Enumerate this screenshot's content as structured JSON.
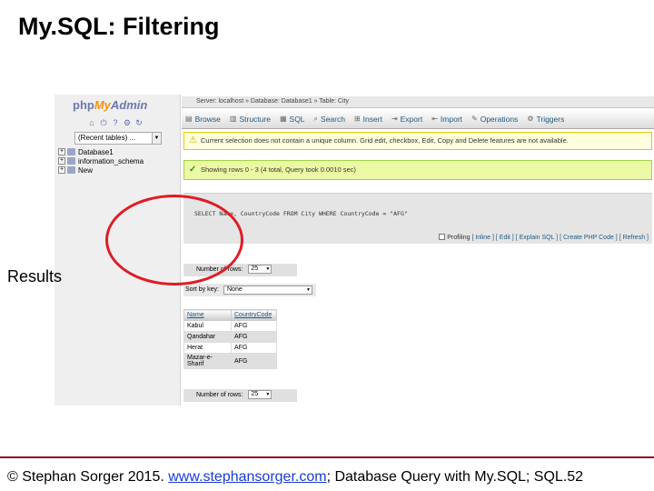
{
  "slide": {
    "title": "My.SQL: Filtering",
    "label": "Results",
    "footer_prefix": "© Stephan Sorger 2015. ",
    "footer_link": "www.stephansorger.com",
    "footer_suffix": "; Database Query with My.SQL;  SQL.52"
  },
  "pma": {
    "logo_php": "php",
    "logo_my": "My",
    "logo_admin": "Admin",
    "recent_select": "(Recent tables) ...",
    "tree": [
      {
        "toggle": "+",
        "label": "Database1"
      },
      {
        "toggle": "+",
        "label": "information_schema"
      },
      {
        "toggle": "+",
        "label": "New"
      }
    ],
    "breadcrumb": "Server: localhost  »  Database: Database1  »  Table: City",
    "tabs": [
      {
        "icon": "browse-icon",
        "glyph": "▤",
        "label": "Browse"
      },
      {
        "icon": "structure-icon",
        "glyph": "▥",
        "label": "Structure"
      },
      {
        "icon": "sql-icon",
        "glyph": "▦",
        "label": "SQL"
      },
      {
        "icon": "search-icon",
        "glyph": "⌕",
        "label": "Search"
      },
      {
        "icon": "insert-icon",
        "glyph": "⊞",
        "label": "Insert"
      },
      {
        "icon": "export-icon",
        "glyph": "⇥",
        "label": "Export"
      },
      {
        "icon": "import-icon",
        "glyph": "⇤",
        "label": "Import"
      },
      {
        "icon": "operations-icon",
        "glyph": "✎",
        "label": "Operations"
      },
      {
        "icon": "triggers-icon",
        "glyph": "⚙",
        "label": "Triggers"
      }
    ],
    "warning": "Current selection does not contain a unique column. Grid edit, checkbox, Edit, Copy and Delete features are not available.",
    "success": "Showing rows 0 - 3 (4 total, Query took 0.0010 sec)",
    "sql": "SELECT Name, CountryCode FROM City WHERE CountryCode = \"AFG\"",
    "sql_links": {
      "profiling": "Profiling",
      "links": "[ Inline ] [ Edit ] [ Explain SQL ] [ Create PHP Code ] [ Refresh ]"
    },
    "rows_label": "Number of rows:",
    "rows_value": "25",
    "sort_label": "Sort by key:",
    "sort_value": "None",
    "results": {
      "headers": [
        "Name",
        "CountryCode"
      ],
      "rows": [
        [
          "Kabul",
          "AFG"
        ],
        [
          "Qandahar",
          "AFG"
        ],
        [
          "Herat",
          "AFG"
        ],
        [
          "Mazar-e-Sharif",
          "AFG"
        ]
      ]
    }
  },
  "colors": {
    "highlight_circle": "#e01b24",
    "footer_rule": "#8a0f1a",
    "link": "#1a3bd6"
  }
}
